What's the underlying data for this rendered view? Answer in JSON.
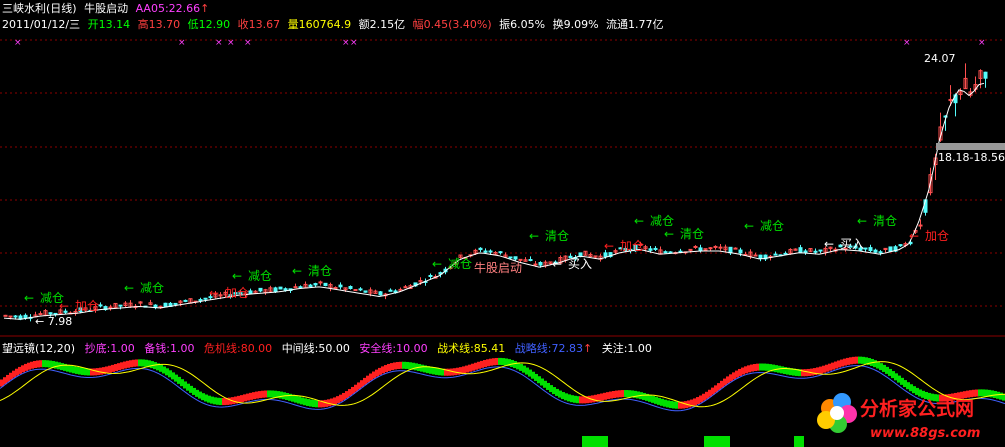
{
  "header": {
    "stock_name": "三峡水利(日线)",
    "indicator_name": "牛股启动",
    "aa_label": "AA05:22.66",
    "aa_arrow": "↑",
    "date": "2011/01/12/三",
    "open": "开13.14",
    "high": "高13.70",
    "low": "低12.90",
    "close": "收13.67",
    "volume": "量160764.9",
    "amount": "额2.15亿",
    "change": "幅0.45(3.40%)",
    "amplitude": "振6.05%",
    "turnover": "换9.09%",
    "float": "流通1.77亿"
  },
  "indicator_header": {
    "name": "望远镜(12,20)",
    "bottom": "抄底:1.00",
    "reserve": "备钱:1.00",
    "crisis": "危机线:80.00",
    "middle": "中间线:50.00",
    "safe": "安全线:10.00",
    "tactic": "战术线:85.41",
    "strategy": "战略线:72.83",
    "strategy_arrow": "↑",
    "focus": "关注:1.00"
  },
  "annotations": {
    "low_price": "← 7.98",
    "high_price": "24.07",
    "range": "18.18-18.56",
    "buy": "买入",
    "add": "加仓",
    "reduce": "减仓",
    "clear": "清仓",
    "start": "牛股启动",
    "arrow_left": "←"
  },
  "logo": {
    "text": "分析家公式网",
    "url": "www.88gs.com"
  },
  "colors": {
    "up": "#ff5050",
    "down": "#54fcfc",
    "ma": "#ffffff",
    "grid": "#8b0000",
    "green": "#00e000",
    "red": "#ff2020",
    "blue": "#4060ff",
    "magenta": "#ff40ff"
  },
  "chart_data": {
    "type": "candlestick",
    "ylim": [
      7.5,
      25
    ],
    "low_marker": 7.98,
    "high_marker": 24.07,
    "price_path": [
      [
        0,
        8.4
      ],
      [
        20,
        8.3
      ],
      [
        40,
        8.5
      ],
      [
        60,
        8.6
      ],
      [
        80,
        8.7
      ],
      [
        100,
        8.9
      ],
      [
        120,
        9.0
      ],
      [
        140,
        9.1
      ],
      [
        160,
        9.0
      ],
      [
        180,
        9.2
      ],
      [
        200,
        9.4
      ],
      [
        220,
        9.6
      ],
      [
        240,
        9.8
      ],
      [
        260,
        9.9
      ],
      [
        280,
        10.0
      ],
      [
        300,
        10.2
      ],
      [
        320,
        10.3
      ],
      [
        340,
        10.1
      ],
      [
        360,
        9.9
      ],
      [
        380,
        9.7
      ],
      [
        400,
        10.0
      ],
      [
        420,
        10.5
      ],
      [
        440,
        11.0
      ],
      [
        460,
        12.0
      ],
      [
        480,
        12.4
      ],
      [
        500,
        12.2
      ],
      [
        520,
        11.8
      ],
      [
        540,
        11.5
      ],
      [
        560,
        11.8
      ],
      [
        580,
        12.2
      ],
      [
        600,
        12.0
      ],
      [
        620,
        12.4
      ],
      [
        640,
        12.6
      ],
      [
        660,
        12.3
      ],
      [
        680,
        12.4
      ],
      [
        700,
        12.5
      ],
      [
        720,
        12.5
      ],
      [
        740,
        12.3
      ],
      [
        760,
        12.0
      ],
      [
        780,
        12.2
      ],
      [
        800,
        12.4
      ],
      [
        820,
        12.3
      ],
      [
        840,
        12.6
      ],
      [
        860,
        12.5
      ],
      [
        880,
        12.3
      ],
      [
        900,
        12.6
      ],
      [
        910,
        13.0
      ],
      [
        920,
        14.5
      ],
      [
        930,
        16.5
      ],
      [
        940,
        19.5
      ],
      [
        950,
        21.5
      ],
      [
        960,
        22.5
      ],
      [
        970,
        22.0
      ],
      [
        980,
        22.8
      ]
    ],
    "signals": [
      {
        "label": "加仓",
        "x": 75,
        "y": 310
      },
      {
        "label": "减仓",
        "x": 40,
        "y": 302
      },
      {
        "label": "减仓",
        "x": 140,
        "y": 292
      },
      {
        "label": "加仓",
        "x": 225,
        "y": 297
      },
      {
        "label": "减仓",
        "x": 248,
        "y": 280
      },
      {
        "label": "清仓",
        "x": 308,
        "y": 275
      },
      {
        "label": "减仓",
        "x": 448,
        "y": 268
      },
      {
        "label": "牛股启动",
        "x": 474,
        "y": 272
      },
      {
        "label": "清仓",
        "x": 545,
        "y": 240
      },
      {
        "label": "买入",
        "x": 568,
        "y": 268
      },
      {
        "label": "加仓",
        "x": 620,
        "y": 250
      },
      {
        "label": "减仓",
        "x": 650,
        "y": 225
      },
      {
        "label": "清仓",
        "x": 680,
        "y": 238
      },
      {
        "label": "减仓",
        "x": 760,
        "y": 230
      },
      {
        "label": "买入",
        "x": 840,
        "y": 248
      },
      {
        "label": "清仓",
        "x": 873,
        "y": 225
      },
      {
        "label": "加仓",
        "x": 925,
        "y": 240
      }
    ]
  }
}
